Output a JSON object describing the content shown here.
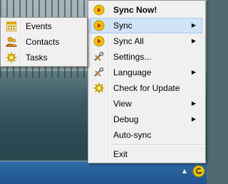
{
  "main_menu": {
    "items": [
      {
        "label": "Sync Now!",
        "icon": "play-icon"
      },
      {
        "label": "Sync",
        "icon": "play-icon",
        "arrow": "▶"
      },
      {
        "label": "Sync All",
        "icon": "play-icon",
        "arrow": "▶"
      },
      {
        "label": "Settings...",
        "icon": "tools-icon"
      },
      {
        "label": "Language",
        "icon": "tools-icon",
        "arrow": "▶"
      },
      {
        "label": "Check for Update",
        "icon": "sun-gear-icon"
      },
      {
        "label": "View",
        "arrow": "▶"
      },
      {
        "label": "Debug",
        "arrow": "▶"
      },
      {
        "label": "Auto-sync"
      },
      {
        "label": "Exit"
      }
    ]
  },
  "sub_menu": {
    "items": [
      {
        "label": "Events",
        "icon": "calendar-icon"
      },
      {
        "label": "Contacts",
        "icon": "contacts-icon"
      },
      {
        "label": "Tasks",
        "icon": "sun-gear-icon"
      }
    ]
  },
  "taskbar": {
    "tray_arrow": "▲"
  },
  "colors": {
    "menu_bg": "#f0f0f0",
    "highlight": "#d1e3f6",
    "taskbar": "#2a609b",
    "icon_yellow": "#f2c200"
  }
}
